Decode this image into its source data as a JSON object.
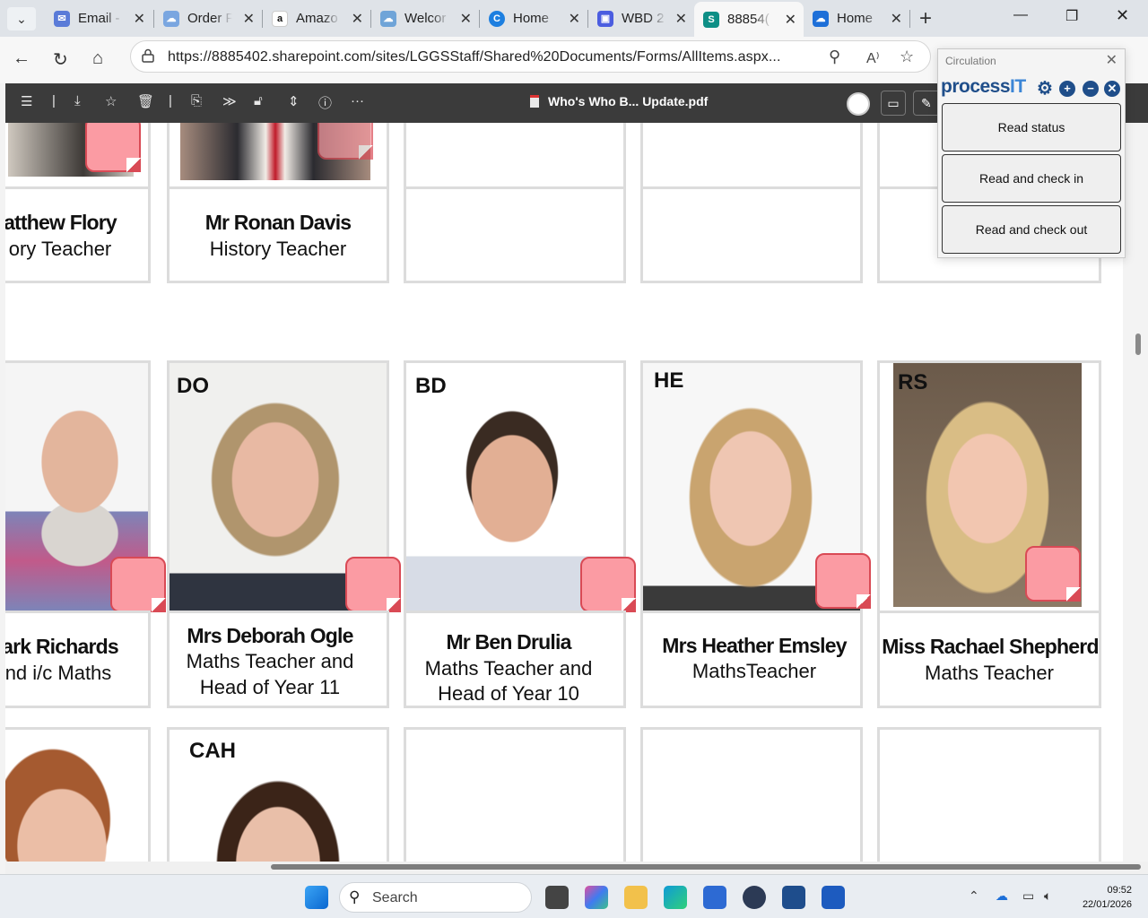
{
  "browser": {
    "tabs": [
      {
        "label": "Email -",
        "color": "#5a7bd8",
        "glyph": "✉"
      },
      {
        "label": "Order F",
        "color": "#7aa6e0",
        "glyph": "☁"
      },
      {
        "label": "Amazo",
        "color": "#ffffff",
        "glyph": "a"
      },
      {
        "label": "Welcor",
        "color": "#6fa4d8",
        "glyph": "☁"
      },
      {
        "label": "Home",
        "color": "#1d7fe0",
        "glyph": "C"
      },
      {
        "label": "WBD 2",
        "color": "#4b5de0",
        "glyph": "▣"
      },
      {
        "label": "88854(",
        "color": "#0e8f86",
        "glyph": "S"
      },
      {
        "label": "Home",
        "color": "#1d6fd8",
        "glyph": "☁"
      }
    ],
    "url": "https://8885402.sharepoint.com/sites/LGGSStaff/Shared%20Documents/Forms/AllItems.aspx..."
  },
  "pdf": {
    "title": "Who's Who B... Update.pdf"
  },
  "staff": {
    "row1": [
      {
        "name": "atthew Flory",
        "role": "ory Teacher"
      },
      {
        "name": "Mr Ronan Davis",
        "role": "History Teacher"
      }
    ],
    "row2": [
      {
        "initials": "",
        "name": "ark Richards",
        "role1": "nd i/c Maths",
        "role2": ""
      },
      {
        "initials": "DO",
        "name": "Mrs Deborah Ogle",
        "role1": "Maths Teacher and",
        "role2": "Head of Year 11"
      },
      {
        "initials": "BD",
        "name": "Mr Ben Drulia",
        "role1": "Maths Teacher and",
        "role2": "Head of Year 10"
      },
      {
        "initials": "HE",
        "name": "Mrs Heather Emsley",
        "role1": "MathsTeacher",
        "role2": ""
      },
      {
        "initials": "RS",
        "name": "Miss Rachael Shepherd",
        "role1": "Maths Teacher",
        "role2": ""
      }
    ],
    "row3": [
      {
        "initials": ""
      },
      {
        "initials": "CAH"
      }
    ]
  },
  "panel": {
    "title": "Circulation",
    "brand_main": "process",
    "brand_it": "IT",
    "buttons": [
      "Read status",
      "Read and check in",
      "Read and check out"
    ]
  },
  "taskbar": {
    "search_label": "Search",
    "time": "09:52",
    "date": "22/01/2026"
  }
}
